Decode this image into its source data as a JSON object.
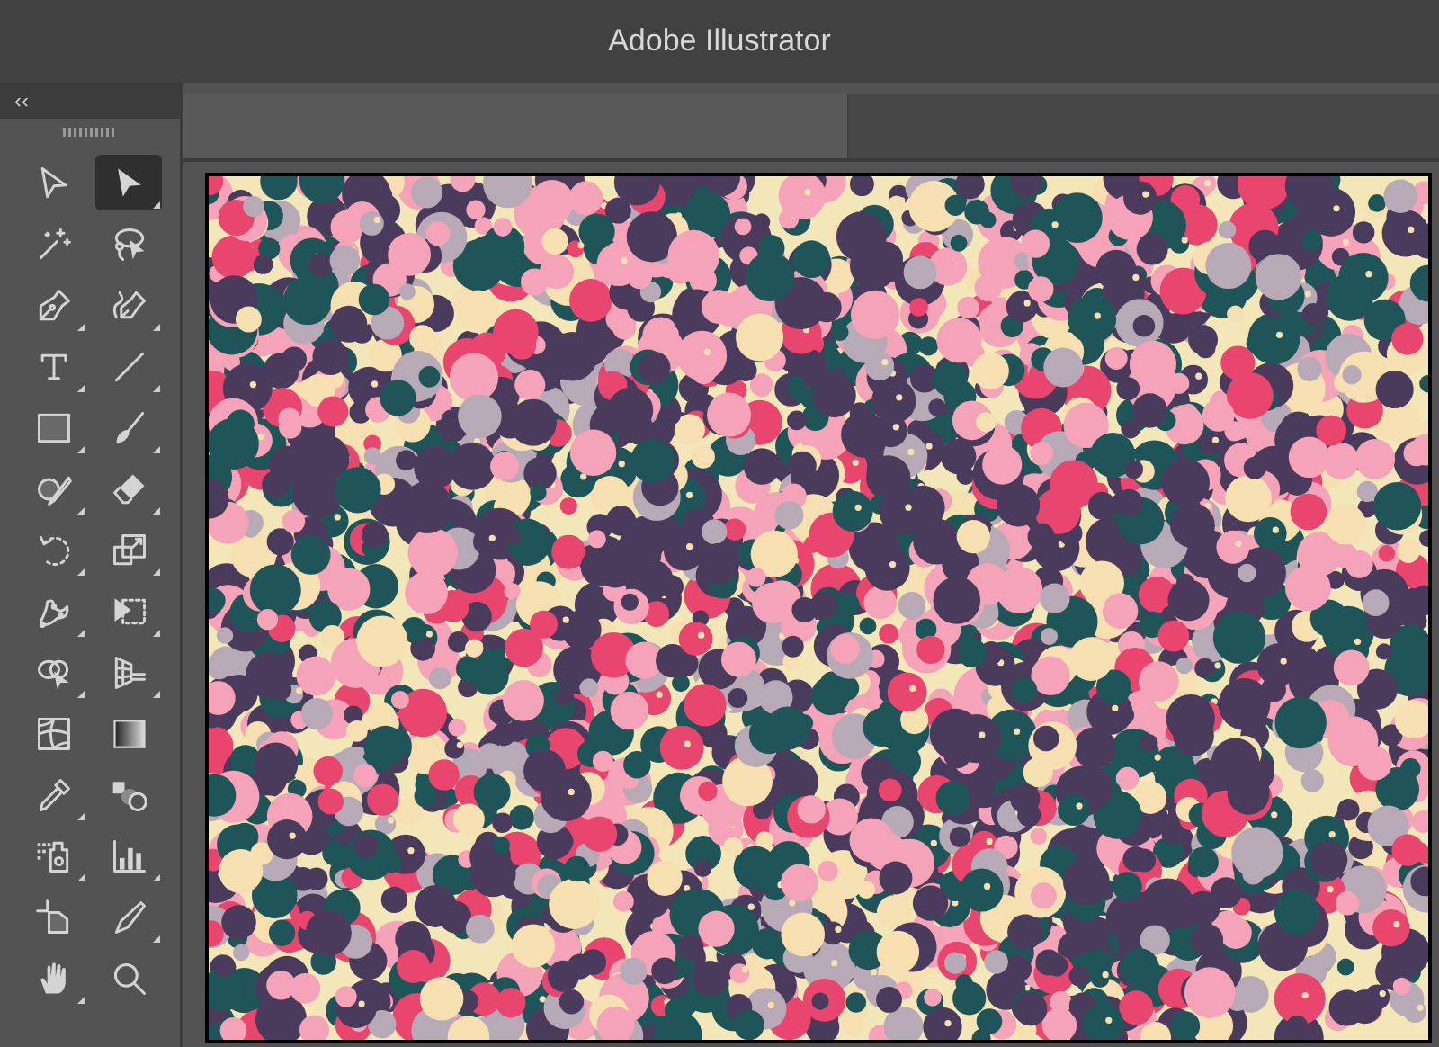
{
  "window": {
    "title": "Adobe Illustrator"
  },
  "toolbar": {
    "collapse_glyph": "‹‹",
    "tools": [
      {
        "selected": false,
        "flyout": false
      },
      {
        "selected": true,
        "flyout": true
      },
      {
        "selected": false,
        "flyout": false
      },
      {
        "selected": false,
        "flyout": false
      },
      {
        "selected": false,
        "flyout": true
      },
      {
        "selected": false,
        "flyout": true
      },
      {
        "selected": false,
        "flyout": true
      },
      {
        "selected": false,
        "flyout": true
      },
      {
        "selected": false,
        "flyout": true
      },
      {
        "selected": false,
        "flyout": true
      },
      {
        "selected": false,
        "flyout": true
      },
      {
        "selected": false,
        "flyout": true
      },
      {
        "selected": false,
        "flyout": true
      },
      {
        "selected": false,
        "flyout": true
      },
      {
        "selected": false,
        "flyout": true
      },
      {
        "selected": false,
        "flyout": true
      },
      {
        "selected": false,
        "flyout": true
      },
      {
        "selected": false,
        "flyout": true
      },
      {
        "selected": false,
        "flyout": false
      },
      {
        "selected": false,
        "flyout": false
      },
      {
        "selected": false,
        "flyout": true
      },
      {
        "selected": false,
        "flyout": false
      },
      {
        "selected": false,
        "flyout": true
      },
      {
        "selected": false,
        "flyout": true
      },
      {
        "selected": false,
        "flyout": false
      },
      {
        "selected": false,
        "flyout": true
      },
      {
        "selected": false,
        "flyout": true
      },
      {
        "selected": false,
        "flyout": false
      }
    ]
  }
}
